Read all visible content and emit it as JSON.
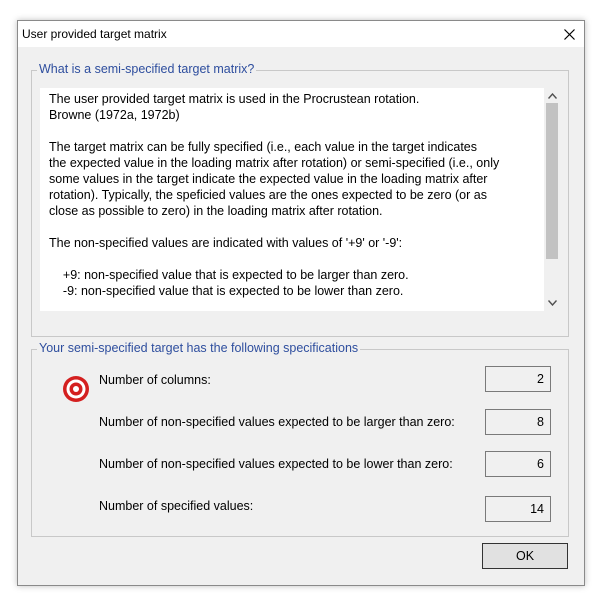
{
  "window": {
    "title": "User provided target matrix"
  },
  "info": {
    "legend": "What is a semi-specified target matrix?",
    "paragraphs": [
      "The user provided target matrix is used in the Procrustean rotation.\nBrowne (1972a, 1972b)",
      "The target matrix can be fully specified (i.e., each value in the target indicates\nthe expected value in the loading matrix after rotation) or semi-specified (i.e., only\nsome values in the target indicate the expected value in the loading matrix after\nrotation). Typically, the speficied values are the ones expected to be zero (or as\nclose as possible to zero) in the loading matrix after rotation.",
      "The non-specified values are indicated with values of '+9' or '-9':",
      "    +9: non-specified value that is expected to be larger than zero.\n    -9: non-specified value that is expected to be lower than zero."
    ]
  },
  "specs": {
    "legend": "Your semi-specified target has the following specifications",
    "rows": [
      {
        "label": "Number of columns:",
        "value": "2"
      },
      {
        "label": "Number of non-specified values expected to be larger than zero:",
        "value": "8"
      },
      {
        "label": "Number of non-specified values expected to be lower than zero:",
        "value": "6"
      },
      {
        "label": "Number of specified values:",
        "value": "14"
      }
    ]
  },
  "buttons": {
    "ok": "OK"
  },
  "icons": {
    "close": "close-icon",
    "target": "target-icon",
    "scroll_up": "chevron-up-icon",
    "scroll_down": "chevron-down-icon"
  },
  "colors": {
    "legend": "#2e4e9e",
    "target_red": "#d42020"
  }
}
